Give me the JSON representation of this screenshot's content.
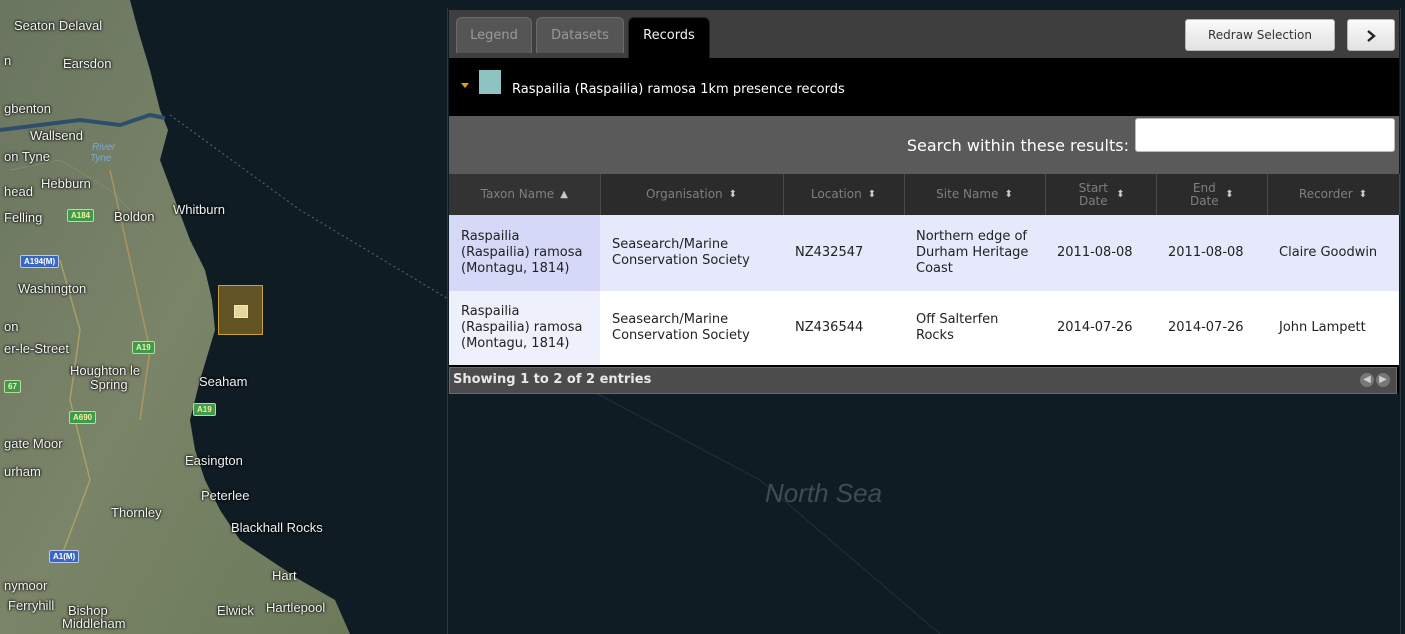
{
  "map": {
    "places": [
      {
        "id": "seaton-delaval",
        "text": "Seaton Delaval"
      },
      {
        "id": "n",
        "text": "n"
      },
      {
        "id": "earsdon",
        "text": "Earsdon"
      },
      {
        "id": "gbenton",
        "text": "gbenton"
      },
      {
        "id": "wallsend",
        "text": "Wallsend"
      },
      {
        "id": "on-tyne",
        "text": "on Tyne"
      },
      {
        "id": "head",
        "text": "head"
      },
      {
        "id": "hebburn",
        "text": "Hebburn"
      },
      {
        "id": "felling",
        "text": "Felling"
      },
      {
        "id": "boldon",
        "text": "Boldon"
      },
      {
        "id": "whitburn",
        "text": "Whitburn"
      },
      {
        "id": "washington",
        "text": "Washington"
      },
      {
        "id": "on2",
        "text": "on"
      },
      {
        "id": "er-le-street",
        "text": "er-le-Street"
      },
      {
        "id": "houghton",
        "text": "Houghton le"
      },
      {
        "id": "spring",
        "text": "Spring"
      },
      {
        "id": "seaham",
        "text": "Seaham"
      },
      {
        "id": "gate-moor",
        "text": "gate Moor"
      },
      {
        "id": "urham",
        "text": "urham"
      },
      {
        "id": "easington",
        "text": "Easington"
      },
      {
        "id": "peterlee",
        "text": "Peterlee"
      },
      {
        "id": "thornley",
        "text": "Thornley"
      },
      {
        "id": "blackhall",
        "text": "Blackhall Rocks"
      },
      {
        "id": "hart",
        "text": "Hart"
      },
      {
        "id": "nymoor",
        "text": "nymoor"
      },
      {
        "id": "ferryhill",
        "text": "Ferryhill"
      },
      {
        "id": "bishop",
        "text": "Bishop"
      },
      {
        "id": "middleham",
        "text": "Middleham"
      },
      {
        "id": "elwick",
        "text": "Elwick"
      },
      {
        "id": "hartlepool",
        "text": "Hartlepool"
      }
    ],
    "rivers": [
      {
        "id": "river",
        "text": "River"
      },
      {
        "id": "tyne",
        "text": "Tyne"
      }
    ],
    "roads": [
      {
        "id": "a184",
        "text": "A184",
        "style": "green"
      },
      {
        "id": "a194m",
        "text": "A194(M)",
        "style": "blue"
      },
      {
        "id": "a19a",
        "text": "A19",
        "style": "green"
      },
      {
        "id": "a67",
        "text": "67",
        "style": "green"
      },
      {
        "id": "a690",
        "text": "A690",
        "style": "green"
      },
      {
        "id": "a19b",
        "text": "A19",
        "style": "green"
      },
      {
        "id": "a1m",
        "text": "A1(M)",
        "style": "blue"
      }
    ],
    "sea_label": "North Sea",
    "land_color": "#6f7c5e",
    "sea_color": "#0f1c24",
    "selection_color": "#c8962a"
  },
  "panel": {
    "tabs": [
      {
        "label": "Legend",
        "active": false
      },
      {
        "label": "Datasets",
        "active": false
      },
      {
        "label": "Records",
        "active": true
      }
    ],
    "redraw_label": "Redraw Selection",
    "next_icon": "chevron-right-icon",
    "section_title": "Raspailia (Raspailia) ramosa 1km presence records",
    "swatch_color": "#8ec3c2",
    "search_label": "Search within these results:",
    "search_value": "",
    "columns": [
      {
        "label": "Taxon Name",
        "sort": "asc"
      },
      {
        "label": "Organisation",
        "sort": "both"
      },
      {
        "label": "Location",
        "sort": "both"
      },
      {
        "label": "Site Name",
        "sort": "both"
      },
      {
        "label": "Start Date",
        "sort": "both"
      },
      {
        "label": "End Date",
        "sort": "both"
      },
      {
        "label": "Recorder",
        "sort": "both"
      }
    ],
    "rows": [
      {
        "taxon": "Raspailia (Raspailia) ramosa (Montagu, 1814)",
        "organisation": "Seasearch/Marine Conservation Society",
        "location": "NZ432547",
        "site": "Northern edge of Durham Heritage Coast",
        "start": "2011-08-08",
        "end": "2011-08-08",
        "recorder": "Claire Goodwin"
      },
      {
        "taxon": "Raspailia (Raspailia) ramosa (Montagu, 1814)",
        "organisation": "Seasearch/Marine Conservation Society",
        "location": "NZ436544",
        "site": "Off Salterfen Rocks",
        "start": "2014-07-26",
        "end": "2014-07-26",
        "recorder": "John Lampett"
      }
    ],
    "footer_text": "Showing 1 to 2 of 2 entries"
  }
}
